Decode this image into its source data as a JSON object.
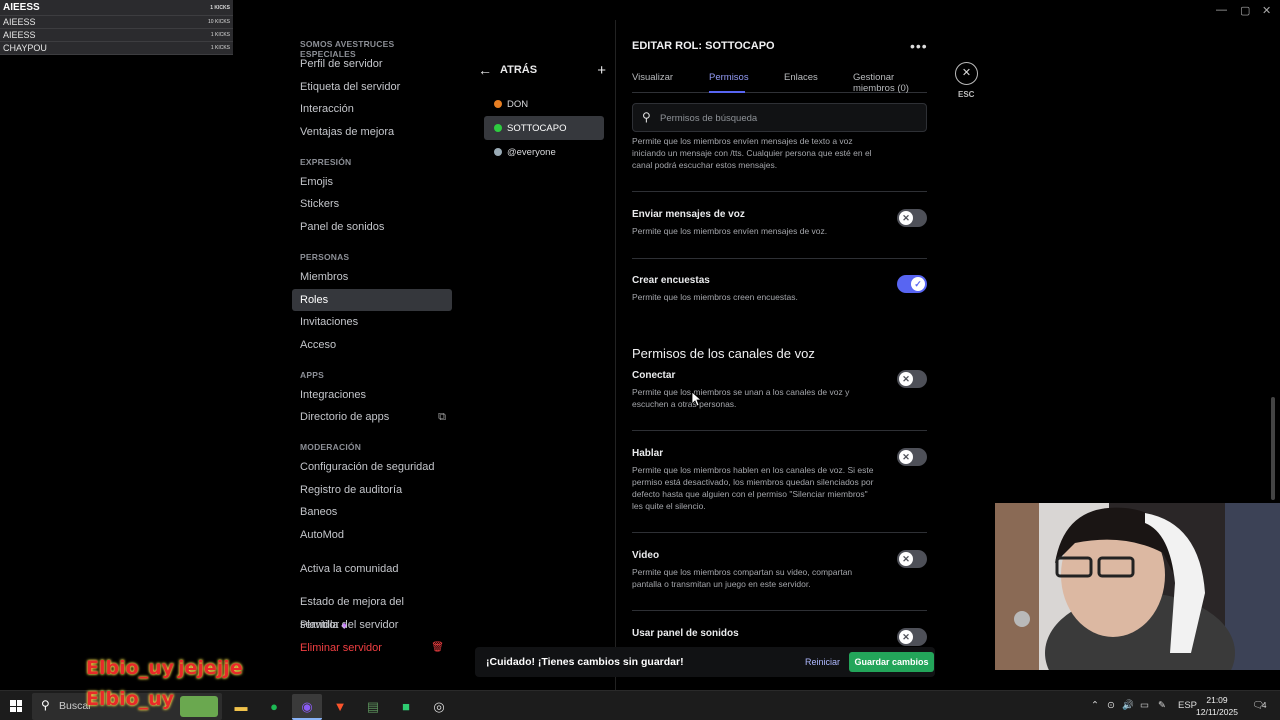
{
  "kicks": [
    {
      "name": "AIEESS",
      "count": "1 KICKS"
    },
    {
      "name": "AIEESS",
      "count": "10 KICKS"
    },
    {
      "name": "AIEESS",
      "count": "1 KICKS"
    },
    {
      "name": "CHAYPOU",
      "count": "1 KICKS"
    }
  ],
  "overlay": {
    "name1": "Elbio_uy",
    "text1": "jejejje",
    "name2": "Elbio_uy"
  },
  "sidebar": {
    "server_header": "SOMOS AVESTRUCES ESPECIALES",
    "server_items": [
      "Perfil de servidor",
      "Etiqueta del servidor",
      "Interacción",
      "Ventajas de mejora"
    ],
    "expression_header": "EXPRESIÓN",
    "expression_items": [
      "Emojis",
      "Stickers",
      "Panel de sonidos"
    ],
    "people_header": "PERSONAS",
    "people_items": [
      "Miembros",
      "Roles",
      "Invitaciones",
      "Acceso"
    ],
    "apps_header": "APPS",
    "apps_items": [
      "Integraciones",
      "Directorio de apps"
    ],
    "moderation_header": "MODERACIÓN",
    "moderation_items": [
      "Configuración de seguridad",
      "Registro de auditoría",
      "Baneos",
      "AutoMod"
    ],
    "community": "Activa la comunidad",
    "boost_status": "Estado de mejora del servidor",
    "template": "Plantilla del servidor",
    "delete": "Eliminar servidor"
  },
  "roles": {
    "back": "ATRÁS",
    "list": [
      {
        "name": "DON",
        "color": "#e67e22"
      },
      {
        "name": "SOTTOCAPO",
        "color": "#2ecc40"
      },
      {
        "name": "@everyone",
        "color": "#99aab5"
      }
    ]
  },
  "editor": {
    "title": "EDITAR ROL: SOTTOCAPO",
    "tabs": [
      "Visualizar",
      "Permisos",
      "Enlaces",
      "Gestionar miembros (0)"
    ],
    "esc": "ESC",
    "search_placeholder": "Permisos de búsqueda",
    "partial_desc": "Permite que los miembros envíen mensajes de texto a voz iniciando un mensaje con /tts. Cualquier persona que esté en el canal podrá escuchar estos mensajes.",
    "permissions": [
      {
        "title": "Enviar mensajes de voz",
        "desc": "Permite que los miembros envíen mensajes de voz.",
        "enabled": false
      },
      {
        "title": "Crear encuestas",
        "desc": "Permite que los miembros creen encuestas.",
        "enabled": true
      }
    ],
    "voice_section": "Permisos de los canales de voz",
    "voice_permissions": [
      {
        "title": "Conectar",
        "desc": "Permite que los miembros se unan a los canales de voz y escuchen a otras personas.",
        "enabled": false
      },
      {
        "title": "Hablar",
        "desc": "Permite que los miembros hablen en los canales de voz. Si este permiso está desactivado, los miembros quedan silenciados por defecto hasta que alguien con el permiso \"Silenciar miembros\" les quite el silencio.",
        "enabled": false
      },
      {
        "title": "Video",
        "desc": "Permite que los miembros compartan su video, compartan pantalla o transmitan un juego en este servidor.",
        "enabled": false
      },
      {
        "title": "Usar panel de sonidos",
        "desc": "",
        "enabled": false
      }
    ]
  },
  "notice": {
    "message": "¡Cuidado! ¡Tienes cambios sin guardar!",
    "reset": "Reiniciar",
    "save": "Guardar cambios"
  },
  "taskbar": {
    "search": "Buscar",
    "lang": "ESP",
    "time": "21:09",
    "date": "12/11/2025",
    "notif_count": "4"
  }
}
